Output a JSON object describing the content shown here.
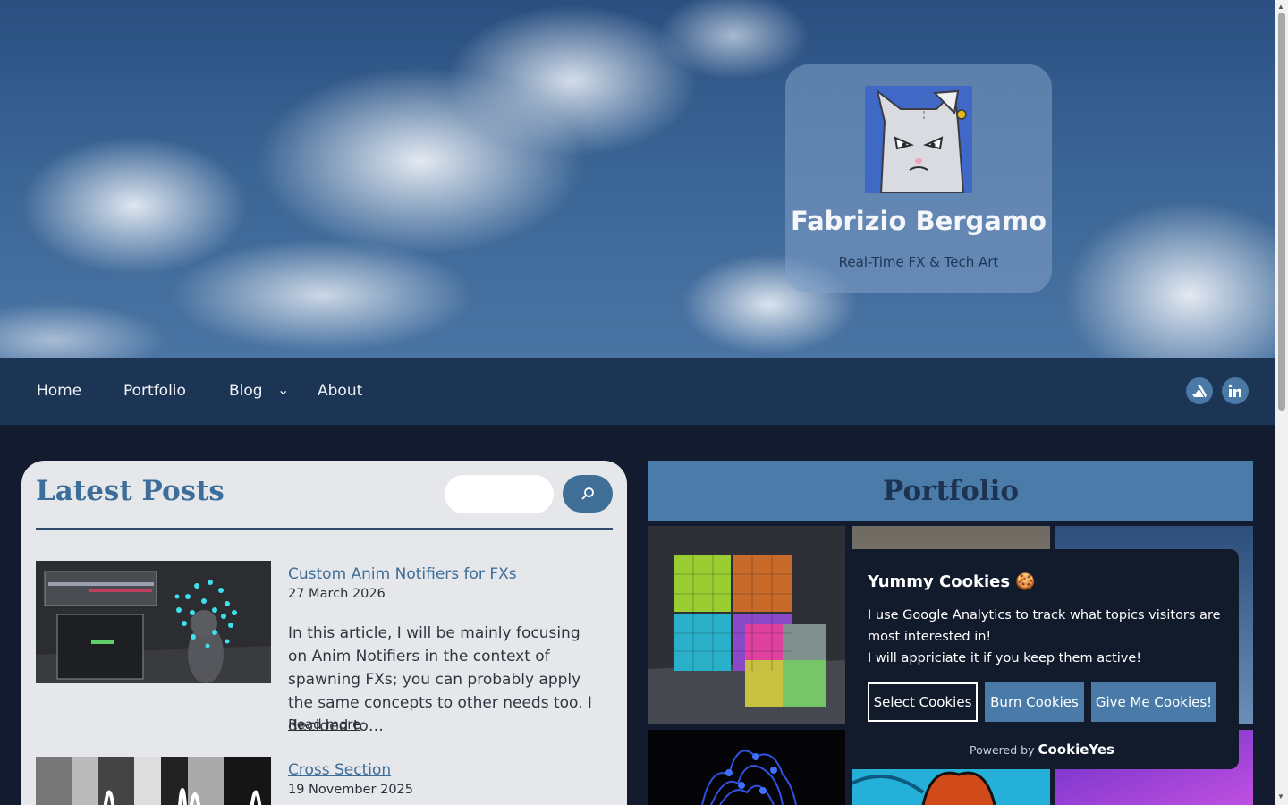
{
  "profile": {
    "name": "Fabrizio Bergamo",
    "tagline": "Real-Time FX & Tech Art"
  },
  "nav": {
    "items": [
      "Home",
      "Portfolio",
      "Blog",
      "About"
    ],
    "socials": [
      "artstation-icon",
      "linkedin-icon"
    ]
  },
  "latest_posts": {
    "title": "Latest Posts",
    "search_placeholder": "",
    "posts": [
      {
        "title": "Custom Anim Notifiers for FXs",
        "date": "27 March 2026",
        "excerpt": "In this article, I will be mainly focusing on Anim Notifiers in the context of spawning FXs; you can probably apply the same concepts to other needs too. I decided to…",
        "read_more": "Read more"
      },
      {
        "title": "Cross Section",
        "date": "19 November 2025"
      }
    ]
  },
  "portfolio": {
    "title": "Portfolio"
  },
  "cookie": {
    "title": "Yummy Cookies 🍪",
    "line1": "I use Google Analytics to track what topics visitors are most interested in!",
    "line2": "I will appriciate it if you keep them active!",
    "buttons": [
      "Select Cookies",
      "Burn Cookies",
      "Give Me Cookies!"
    ],
    "powered_by": "Powered by",
    "brand": "CookieYes"
  },
  "colors": {
    "accent": "#3d6e9a",
    "nav_bg": "#1c3554",
    "page_bg": "#121c2e",
    "cookie_bg": "#121b2c"
  }
}
